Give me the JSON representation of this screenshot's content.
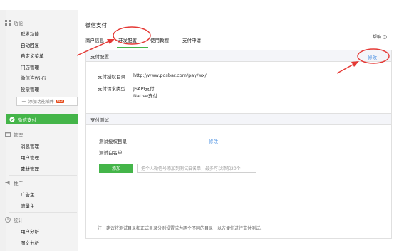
{
  "sidebar": {
    "group_features": "功能",
    "items_features": [
      "群发功能",
      "自动回复",
      "自定义菜单",
      "门店管理",
      "微信连Wi-Fi",
      "投票管理"
    ],
    "add_plugin": "添加功能插件",
    "add_plugin_badge": "NEW",
    "selected": "微信支付",
    "group_manage": "管理",
    "items_manage": [
      "消息管理",
      "用户管理",
      "素材管理"
    ],
    "group_promo": "推广",
    "items_promo": [
      "广告主",
      "流量主"
    ],
    "group_stats": "统计",
    "items_stats": [
      "用户分析",
      "图文分析"
    ]
  },
  "header": {
    "title": "微信支付",
    "tabs": [
      "商户信息",
      "开发配置",
      "使用教程",
      "支付申请"
    ],
    "active_tab": "开发配置",
    "help": "帮助"
  },
  "config_panel": {
    "title": "支付配置",
    "edit_link": "修改",
    "auth_dir_label": "支付授权目录",
    "auth_dir_value": "http://www.posbar.com/pay/wx/",
    "req_type_label": "支付请求类型",
    "req_type_values": [
      "JSAPI支付",
      "Native支付"
    ]
  },
  "test_panel": {
    "title": "支付测试",
    "test_dir_label": "测试授权目录",
    "test_dir_edit": "修改",
    "whitelist_label": "测试白名单",
    "add_button": "添加",
    "input_placeholder": "把个人微信号添加到测试白名单，最多可以添加20个",
    "note": "注：建议将测试目录和正式目录分别设置成为两个不同的目录，以方便你进行支付测试。"
  },
  "annotation_color": "#e53935",
  "accent_color": "#44b549"
}
